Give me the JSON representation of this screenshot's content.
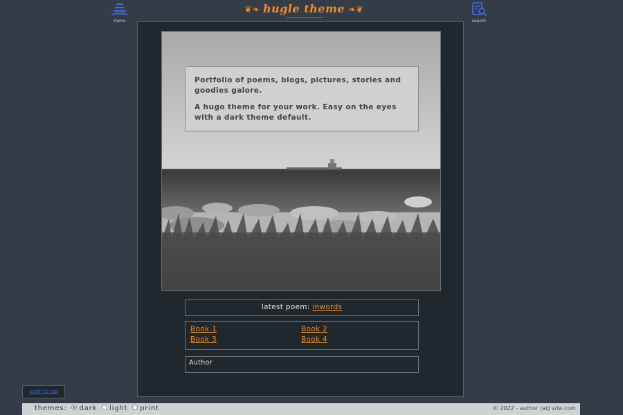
{
  "header": {
    "menu_label": "menu",
    "title": "hugle theme",
    "search_label": "search"
  },
  "intro": {
    "p1": "Portfolio of poems, blogs, pictures, stories and goodies galore.",
    "p2": "A hugo theme for your work. Easy on the eyes with a dark theme default."
  },
  "latest": {
    "prefix": "latest poem:",
    "link": "inwords"
  },
  "books": [
    {
      "label": "Book 1"
    },
    {
      "label": "Book 2"
    },
    {
      "label": "Book 3"
    },
    {
      "label": "Book 4"
    }
  ],
  "author": {
    "label": "Author"
  },
  "scroll_top": "scroll to top",
  "footer": {
    "themes_label": "themes:",
    "options": [
      "dark",
      "light",
      "print"
    ],
    "selected": "dark",
    "copyright": "© 2022 - author (at) site.com"
  },
  "colors": {
    "background": "#333c47",
    "panel": "#21282d",
    "accent": "#f08a26",
    "link_blue": "#3d6ad6"
  },
  "icons": {
    "menu": "hamburger-icon",
    "search": "document-search-icon",
    "ornament": "flourish-icon"
  }
}
